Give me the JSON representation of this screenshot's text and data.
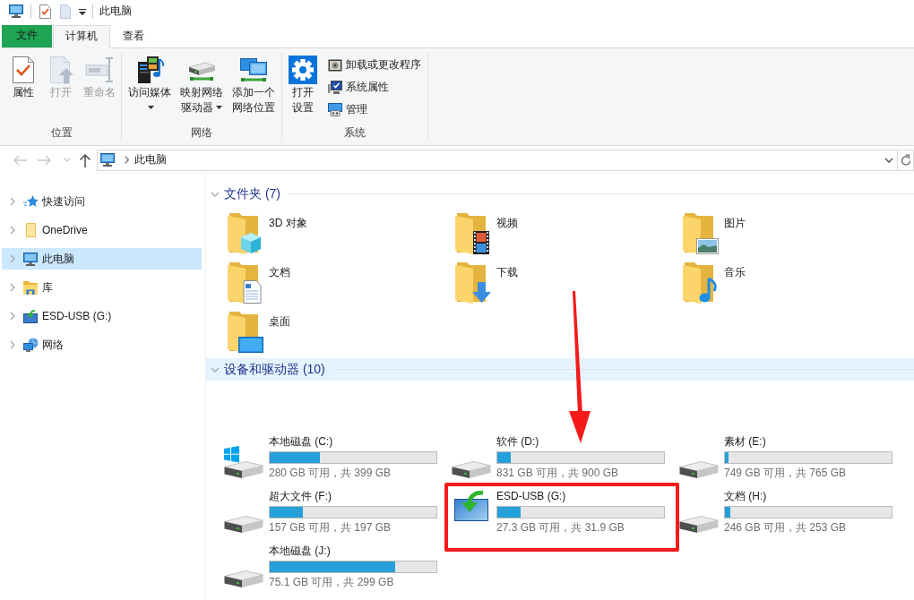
{
  "window": {
    "title": "此电脑"
  },
  "quick_access_toolbar": [
    {
      "kind": "properties"
    },
    {
      "kind": "newfolder"
    },
    {
      "kind": "customize"
    }
  ],
  "ribbon": {
    "tabs": [
      {
        "label": "文件",
        "kind": "menu",
        "selected": false
      },
      {
        "label": "计算机",
        "kind": "tab",
        "selected": true
      },
      {
        "label": "查看",
        "kind": "tab",
        "selected": false
      }
    ],
    "groups": [
      {
        "label": "位置",
        "buttons": [
          {
            "label": "属性",
            "kind": "properties",
            "disabled": false,
            "dropdown": false
          },
          {
            "label": "打开",
            "kind": "open",
            "disabled": true,
            "dropdown": false
          },
          {
            "label": "重命名",
            "kind": "rename",
            "disabled": true,
            "dropdown": false
          }
        ]
      },
      {
        "label": "网络",
        "buttons": [
          {
            "label": "访问媒体",
            "kind": "media",
            "disabled": false,
            "dropdown": true
          },
          {
            "label": "映射网络驱动器",
            "kind": "mapdrive",
            "disabled": false,
            "dropdown": true
          },
          {
            "label": "添加一个网络位置",
            "kind": "netlocation",
            "disabled": false,
            "dropdown": false
          }
        ]
      },
      {
        "label": "系统",
        "buttons": [
          {
            "label": "打开设置",
            "kind": "settings",
            "disabled": false,
            "dropdown": false
          }
        ],
        "small_buttons": [
          {
            "label": "卸载或更改程序",
            "kind": "uninstall"
          },
          {
            "label": "系统属性",
            "kind": "sysprops"
          },
          {
            "label": "管理",
            "kind": "manage"
          }
        ]
      }
    ]
  },
  "navigation": {
    "buttons": [
      {
        "kind": "back",
        "disabled": true
      },
      {
        "kind": "forward",
        "disabled": true
      },
      {
        "kind": "recent",
        "disabled": true
      },
      {
        "kind": "up",
        "disabled": false
      }
    ],
    "address": {
      "path": [
        "此电脑"
      ]
    }
  },
  "sidebar": {
    "items": [
      {
        "label": "快速访问",
        "kind": "quickaccess",
        "selected": false,
        "expanded": false
      },
      {
        "label": "OneDrive",
        "kind": "onedrive",
        "selected": false,
        "expanded": false
      },
      {
        "label": "此电脑",
        "kind": "thispc",
        "selected": true,
        "expanded": false
      },
      {
        "label": "库",
        "kind": "libraries",
        "selected": false,
        "expanded": false
      },
      {
        "label": "ESD-USB (G:)",
        "kind": "usb",
        "selected": false,
        "expanded": false
      },
      {
        "label": "网络",
        "kind": "network",
        "selected": false,
        "expanded": false
      }
    ]
  },
  "content": {
    "folders": {
      "title": "文件夹 (7)",
      "expanded": true,
      "hovered": false,
      "items": [
        {
          "label": "3D 对象",
          "kind": "objects"
        },
        {
          "label": "视频",
          "kind": "videos"
        },
        {
          "label": "图片",
          "kind": "pictures"
        },
        {
          "label": "文档",
          "kind": "documents"
        },
        {
          "label": "下载",
          "kind": "downloads"
        },
        {
          "label": "音乐",
          "kind": "music"
        },
        {
          "label": "桌面",
          "kind": "desktop"
        }
      ]
    },
    "devices": {
      "title": "设备和驱动器 (10)",
      "expanded": true,
      "hovered": true,
      "items": [
        {
          "name": "本地磁盘 (C:)",
          "kind": "system",
          "level": 0.3,
          "space": "280 GB 可用，共 399 GB",
          "annotated": false
        },
        {
          "name": "软件 (D:)",
          "kind": "disk",
          "level": 0.08,
          "space": "831 GB 可用，共 900 GB",
          "annotated": false
        },
        {
          "name": "素材 (E:)",
          "kind": "disk",
          "level": 0.02,
          "space": "749 GB 可用，共 765 GB",
          "annotated": false
        },
        {
          "name": "超大文件 (F:)",
          "kind": "disk",
          "level": 0.2,
          "space": "157 GB 可用，共 197 GB",
          "annotated": false
        },
        {
          "name": "ESD-USB (G:)",
          "kind": "usb",
          "level": 0.14,
          "space": "27.3 GB 可用，共 31.9 GB",
          "annotated": true
        },
        {
          "name": "文档 (H:)",
          "kind": "disk",
          "level": 0.03,
          "space": "246 GB 可用，共 253 GB",
          "annotated": false
        },
        {
          "name": "本地磁盘 (J:)",
          "kind": "disk",
          "level": 0.75,
          "space": "75.1 GB 可用，共 299 GB",
          "annotated": false
        }
      ]
    }
  }
}
